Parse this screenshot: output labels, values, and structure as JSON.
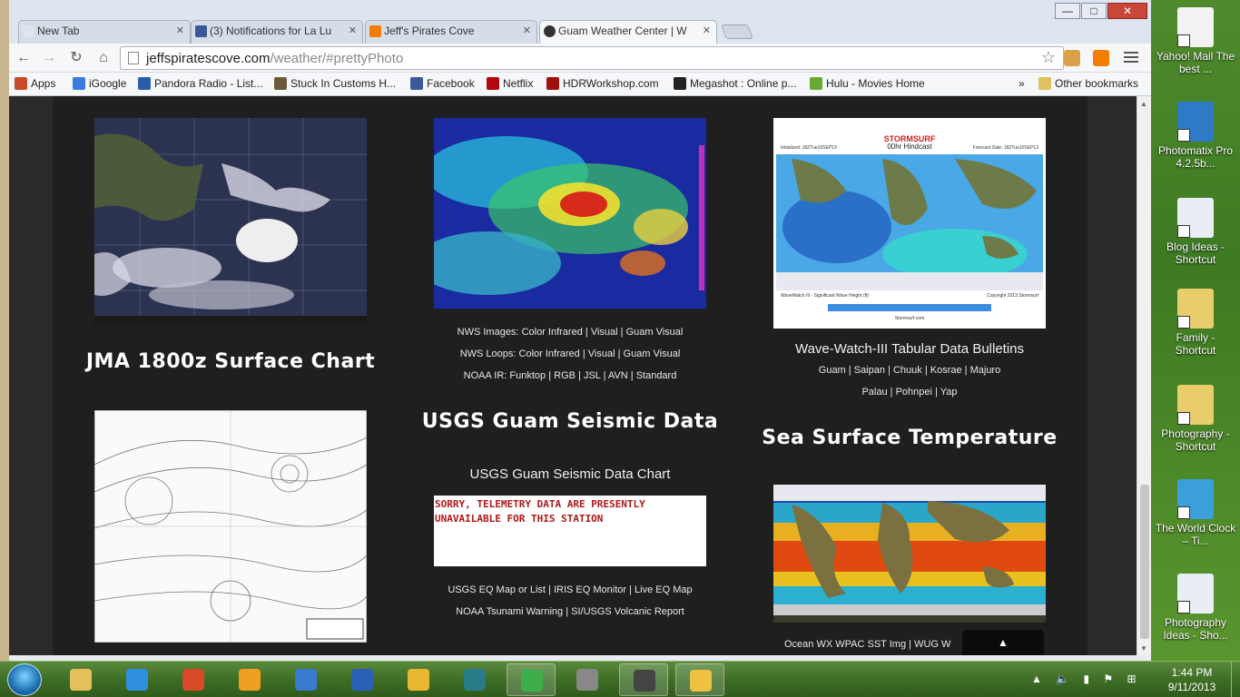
{
  "browser": {
    "tabs": [
      {
        "title": "New Tab",
        "favicon": "new-tab-icon",
        "active": false
      },
      {
        "title": "(3) Notifications for La Lu",
        "favicon": "facebook-icon",
        "active": false
      },
      {
        "title": "Jeff's Pirates Cove",
        "favicon": "blogger-icon",
        "active": false
      },
      {
        "title": "Guam Weather Center | W",
        "favicon": "pirate-skull-icon",
        "active": true
      }
    ],
    "url": {
      "domain": "jeffspiratescove.com",
      "path": "/weather/#prettyPhoto"
    },
    "window_buttons": {
      "minimize": "—",
      "maximize": "□",
      "close": "✕"
    },
    "bookmarks": [
      {
        "label": "Apps",
        "icon": "apps-grid-icon",
        "color": "#c94a2b"
      },
      {
        "label": "iGoogle",
        "icon": "google-icon",
        "color": "#3b7be0"
      },
      {
        "label": "Pandora Radio - List...",
        "icon": "pandora-icon",
        "color": "#2a5da8"
      },
      {
        "label": "Stuck In Customs H...",
        "icon": "stuck-in-customs-icon",
        "color": "#6a5a3a"
      },
      {
        "label": "Facebook",
        "icon": "facebook-icon",
        "color": "#3b5998"
      },
      {
        "label": "Netflix",
        "icon": "netflix-icon",
        "color": "#b00710"
      },
      {
        "label": "HDRWorkshop.com",
        "icon": "hdr-icon",
        "color": "#a01010"
      },
      {
        "label": "Megashot : Online p...",
        "icon": "megashot-icon",
        "color": "#222222"
      },
      {
        "label": "Hulu - Movies Home",
        "icon": "hulu-icon",
        "color": "#66aa33"
      }
    ],
    "other_bookmarks": "Other bookmarks",
    "overflow_chevron": "»"
  },
  "page": {
    "col1": {
      "heading": "JMA 1800z Surface Chart"
    },
    "col2": {
      "links1": [
        "NWS Images:",
        "Color Infrared",
        "Visual",
        "Guam Visual"
      ],
      "links2": [
        "NWS Loops:",
        "Color Infrared",
        "Visual",
        "Guam Visual"
      ],
      "links3": [
        "NOAA IR:",
        "Funktop",
        "RGB",
        "JSL",
        "AVN",
        "Standard"
      ],
      "heading": "USGS Guam Seismic Data",
      "subhead": "USGS Guam Seismic Data Chart",
      "telemetry": "SORRY, TELEMETRY DATA ARE PRESENTLY\nUNAVAILABLE FOR THIS STATION",
      "links4": [
        "USGS EQ Map or List",
        "IRIS EQ Monitor",
        "Live EQ Map"
      ],
      "links5": [
        "NOAA Tsunami Warning",
        "SI/USGS Volcanic Report"
      ]
    },
    "col3": {
      "stormsurf": {
        "brand": "STORMSURF",
        "subtitle": "00hr Hindcast",
        "init": "Initialized: 18ZTue10SEP13",
        "forecast": "Forecast Date: 18ZTue10SEP13",
        "caption": "WaveWatch III - Significant Wave Height (ft)",
        "copyright": "Copyright 2013 Stormsurf",
        "footer": "Stormsurf.com"
      },
      "subhead": "Wave-Watch-III Tabular Data Bulletins",
      "links1": [
        "Guam",
        "Saipan",
        "Chuuk",
        "Kosrae",
        "Majuro"
      ],
      "links2": [
        "Palau",
        "Pohnpei",
        "Yap"
      ],
      "heading": "Sea Surface Temperature",
      "links3": [
        "Ocean WX WPAC SST Img",
        "WUG W"
      ]
    },
    "to_top": "▲"
  },
  "desktop_icons": [
    {
      "label": "Yahoo! Mail The best ...",
      "icon": "yahoo-mail-icon",
      "color": "#f2f2f2"
    },
    {
      "label": "Photomatix Pro 4.2.5b...",
      "icon": "photomatix-icon",
      "color": "#2f79c9"
    },
    {
      "label": "Blog Ideas - Shortcut",
      "icon": "word-document-icon",
      "color": "#e9eef6"
    },
    {
      "label": "Family - Shortcut",
      "icon": "folder-icon",
      "color": "#e9cc6b"
    },
    {
      "label": "Photography - Shortcut",
      "icon": "folder-icon",
      "color": "#e9cc6b"
    },
    {
      "label": "The World Clock – Ti...",
      "icon": "world-clock-icon",
      "color": "#3b9fdc"
    },
    {
      "label": "Photography Ideas - Sho...",
      "icon": "word-document-icon",
      "color": "#e9eef6"
    }
  ],
  "taskbar": {
    "apps": [
      {
        "name": "file-explorer-icon",
        "color": "#e4c05c",
        "open": false
      },
      {
        "name": "internet-explorer-icon",
        "color": "#2f8fe0",
        "open": false
      },
      {
        "name": "flash-icon",
        "color": "#d94a2a",
        "open": false
      },
      {
        "name": "media-player-icon",
        "color": "#f0a020",
        "open": false
      },
      {
        "name": "quicktime-icon",
        "color": "#3a7ad0",
        "open": false
      },
      {
        "name": "word-icon",
        "color": "#2b5fb5",
        "open": false
      },
      {
        "name": "outlook-icon",
        "color": "#e8b830",
        "open": false
      },
      {
        "name": "publisher-icon",
        "color": "#2a7b8a",
        "open": false
      },
      {
        "name": "chrome-icon",
        "color": "#3cae4a",
        "open": true
      },
      {
        "name": "picasa-icon",
        "color": "#888888",
        "open": false
      },
      {
        "name": "camera-icon",
        "color": "#444444",
        "open": true
      },
      {
        "name": "photo-app-icon",
        "color": "#f0c040",
        "open": true
      }
    ],
    "time": "1:44 PM",
    "date": "9/11/2013"
  }
}
